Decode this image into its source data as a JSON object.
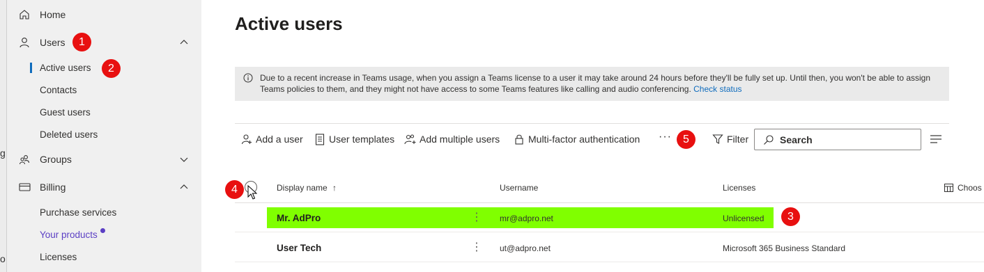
{
  "left_strip": {
    "fragments": [
      "g",
      "o"
    ]
  },
  "sidebar": {
    "home": "Home",
    "users": "Users",
    "users_sub": [
      "Active users",
      "Contacts",
      "Guest users",
      "Deleted users"
    ],
    "groups": "Groups",
    "billing": "Billing",
    "billing_sub": [
      "Purchase services",
      "Your products",
      "Licenses"
    ]
  },
  "page": {
    "title": "Active users",
    "notice_text": "Due to a recent increase in Teams usage, when you assign a Teams license to a user it may take around 24 hours before they'll be fully set up. Until then, you won't be able to assign Teams policies to them, and they might not have access to some Teams features like calling and audio conferencing.",
    "notice_link": "Check status"
  },
  "toolbar": {
    "add_user": "Add a user",
    "user_templates": "User templates",
    "add_multiple": "Add multiple users",
    "mfa": "Multi-factor authentication",
    "more": "···",
    "filter": "Filter",
    "search_placeholder": "Search"
  },
  "table": {
    "columns": [
      "Display name",
      "Username",
      "Licenses"
    ],
    "sort_indicator": "↑",
    "choose_columns": "Choos",
    "rows": [
      {
        "display_name": "Mr. AdPro",
        "username": "mr@adpro.net",
        "licenses": "Unlicensed",
        "highlighted": true
      },
      {
        "display_name": "User Tech",
        "username": "ut@adpro.net",
        "licenses": "Microsoft 365 Business Standard",
        "highlighted": false
      }
    ]
  },
  "annotations": [
    "1",
    "2",
    "3",
    "4",
    "5"
  ],
  "colors": {
    "accent": "#0f6cbd",
    "highlight": "#80ff00",
    "annotation": "#e81010",
    "purple": "#5b3fc4"
  }
}
